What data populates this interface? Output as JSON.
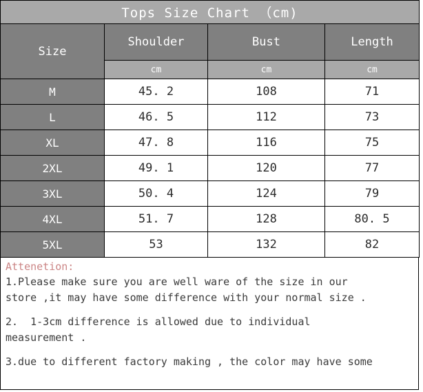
{
  "chart_data": {
    "type": "table",
    "title": "Tops  Size Chart  （cm)",
    "columns": [
      "Size",
      "Shoulder",
      "Bust",
      "Length"
    ],
    "units_row": [
      "",
      "cm",
      "cm",
      "cm"
    ],
    "rows": [
      {
        "size": "M",
        "shoulder": "45. 2",
        "bust": "108",
        "length": "71"
      },
      {
        "size": "L",
        "shoulder": "46. 5",
        "bust": "112",
        "length": "73"
      },
      {
        "size": "XL",
        "shoulder": "47. 8",
        "bust": "116",
        "length": "75"
      },
      {
        "size": "2XL",
        "shoulder": "49. 1",
        "bust": "120",
        "length": "77"
      },
      {
        "size": "3XL",
        "shoulder": "50. 4",
        "bust": "124",
        "length": "79"
      },
      {
        "size": "4XL",
        "shoulder": "51. 7",
        "bust": "128",
        "length": "80. 5"
      },
      {
        "size": "5XL",
        "shoulder": "53",
        "bust": "132",
        "length": "82"
      }
    ]
  },
  "table": {
    "title": "Tops  Size Chart  （cm)",
    "header": {
      "size": "Size",
      "shoulder": "Shoulder",
      "bust": "Bust",
      "length": "Length",
      "unit_shoulder": "cm",
      "unit_bust": "cm",
      "unit_length": "cm"
    },
    "rows": [
      {
        "size": "M",
        "shoulder": "45. 2",
        "bust": "108",
        "length": "71"
      },
      {
        "size": "L",
        "shoulder": "46. 5",
        "bust": "112",
        "length": "73"
      },
      {
        "size": "XL",
        "shoulder": "47. 8",
        "bust": "116",
        "length": "75"
      },
      {
        "size": "2XL",
        "shoulder": "49. 1",
        "bust": "120",
        "length": "77"
      },
      {
        "size": "3XL",
        "shoulder": "50. 4",
        "bust": "124",
        "length": "79"
      },
      {
        "size": "4XL",
        "shoulder": "51. 7",
        "bust": "128",
        "length": "80. 5"
      },
      {
        "size": "5XL",
        "shoulder": "53",
        "bust": "132",
        "length": "82"
      }
    ]
  },
  "notes": {
    "heading": "Attenetion:",
    "line1": "1.Please make sure you are well ware of the size in our",
    "line2": "store ,it may have some difference with your normal size .",
    "line3": "2.  1-3cm difference is allowed due to individual",
    "line4": "measurement .",
    "line5": "3.due to different factory making , the color may have some"
  },
  "colors": {
    "title_bar": "#a9a9a9",
    "header_dark": "#808080",
    "unit_band": "#a9a9a9",
    "row_label": "#808080",
    "cell_text": "#2b2b2b",
    "attention": "#cb8585",
    "border": "#000000"
  }
}
